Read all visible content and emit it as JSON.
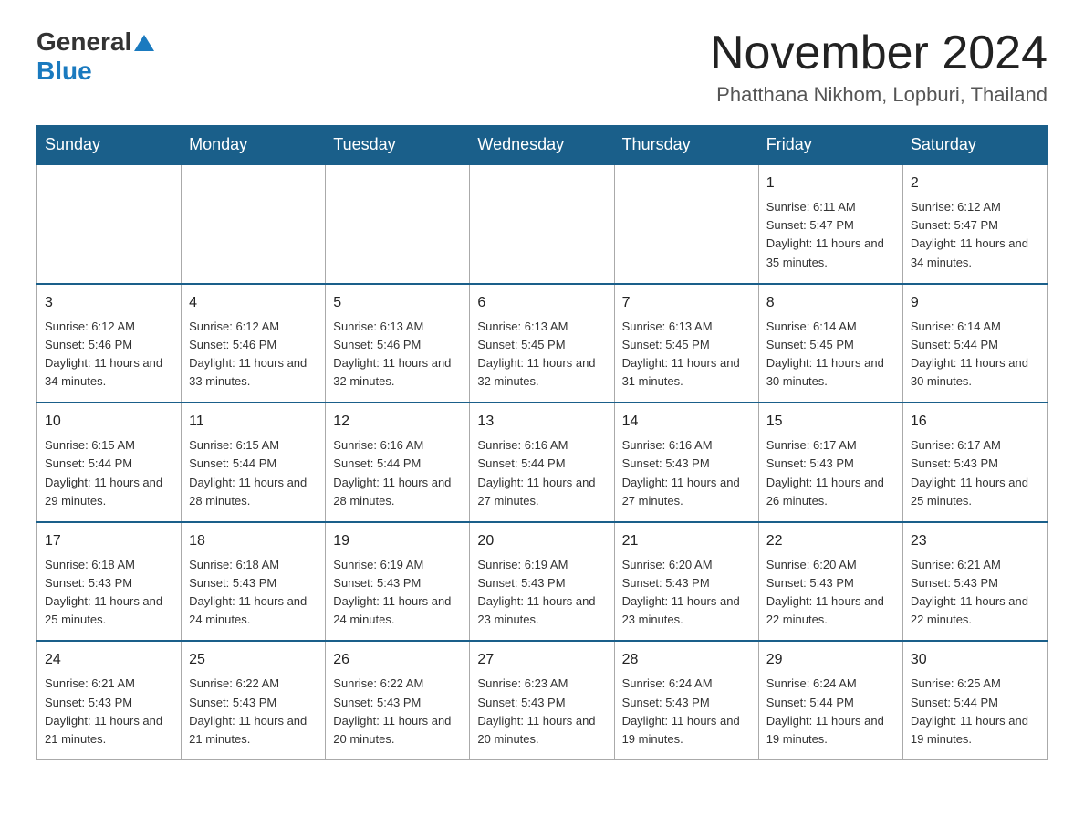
{
  "header": {
    "logo_general": "General",
    "logo_blue": "Blue",
    "month_title": "November 2024",
    "location": "Phatthana Nikhom, Lopburi, Thailand"
  },
  "weekdays": [
    "Sunday",
    "Monday",
    "Tuesday",
    "Wednesday",
    "Thursday",
    "Friday",
    "Saturday"
  ],
  "weeks": [
    [
      {
        "day": "",
        "info": ""
      },
      {
        "day": "",
        "info": ""
      },
      {
        "day": "",
        "info": ""
      },
      {
        "day": "",
        "info": ""
      },
      {
        "day": "",
        "info": ""
      },
      {
        "day": "1",
        "info": "Sunrise: 6:11 AM\nSunset: 5:47 PM\nDaylight: 11 hours and 35 minutes."
      },
      {
        "day": "2",
        "info": "Sunrise: 6:12 AM\nSunset: 5:47 PM\nDaylight: 11 hours and 34 minutes."
      }
    ],
    [
      {
        "day": "3",
        "info": "Sunrise: 6:12 AM\nSunset: 5:46 PM\nDaylight: 11 hours and 34 minutes."
      },
      {
        "day": "4",
        "info": "Sunrise: 6:12 AM\nSunset: 5:46 PM\nDaylight: 11 hours and 33 minutes."
      },
      {
        "day": "5",
        "info": "Sunrise: 6:13 AM\nSunset: 5:46 PM\nDaylight: 11 hours and 32 minutes."
      },
      {
        "day": "6",
        "info": "Sunrise: 6:13 AM\nSunset: 5:45 PM\nDaylight: 11 hours and 32 minutes."
      },
      {
        "day": "7",
        "info": "Sunrise: 6:13 AM\nSunset: 5:45 PM\nDaylight: 11 hours and 31 minutes."
      },
      {
        "day": "8",
        "info": "Sunrise: 6:14 AM\nSunset: 5:45 PM\nDaylight: 11 hours and 30 minutes."
      },
      {
        "day": "9",
        "info": "Sunrise: 6:14 AM\nSunset: 5:44 PM\nDaylight: 11 hours and 30 minutes."
      }
    ],
    [
      {
        "day": "10",
        "info": "Sunrise: 6:15 AM\nSunset: 5:44 PM\nDaylight: 11 hours and 29 minutes."
      },
      {
        "day": "11",
        "info": "Sunrise: 6:15 AM\nSunset: 5:44 PM\nDaylight: 11 hours and 28 minutes."
      },
      {
        "day": "12",
        "info": "Sunrise: 6:16 AM\nSunset: 5:44 PM\nDaylight: 11 hours and 28 minutes."
      },
      {
        "day": "13",
        "info": "Sunrise: 6:16 AM\nSunset: 5:44 PM\nDaylight: 11 hours and 27 minutes."
      },
      {
        "day": "14",
        "info": "Sunrise: 6:16 AM\nSunset: 5:43 PM\nDaylight: 11 hours and 27 minutes."
      },
      {
        "day": "15",
        "info": "Sunrise: 6:17 AM\nSunset: 5:43 PM\nDaylight: 11 hours and 26 minutes."
      },
      {
        "day": "16",
        "info": "Sunrise: 6:17 AM\nSunset: 5:43 PM\nDaylight: 11 hours and 25 minutes."
      }
    ],
    [
      {
        "day": "17",
        "info": "Sunrise: 6:18 AM\nSunset: 5:43 PM\nDaylight: 11 hours and 25 minutes."
      },
      {
        "day": "18",
        "info": "Sunrise: 6:18 AM\nSunset: 5:43 PM\nDaylight: 11 hours and 24 minutes."
      },
      {
        "day": "19",
        "info": "Sunrise: 6:19 AM\nSunset: 5:43 PM\nDaylight: 11 hours and 24 minutes."
      },
      {
        "day": "20",
        "info": "Sunrise: 6:19 AM\nSunset: 5:43 PM\nDaylight: 11 hours and 23 minutes."
      },
      {
        "day": "21",
        "info": "Sunrise: 6:20 AM\nSunset: 5:43 PM\nDaylight: 11 hours and 23 minutes."
      },
      {
        "day": "22",
        "info": "Sunrise: 6:20 AM\nSunset: 5:43 PM\nDaylight: 11 hours and 22 minutes."
      },
      {
        "day": "23",
        "info": "Sunrise: 6:21 AM\nSunset: 5:43 PM\nDaylight: 11 hours and 22 minutes."
      }
    ],
    [
      {
        "day": "24",
        "info": "Sunrise: 6:21 AM\nSunset: 5:43 PM\nDaylight: 11 hours and 21 minutes."
      },
      {
        "day": "25",
        "info": "Sunrise: 6:22 AM\nSunset: 5:43 PM\nDaylight: 11 hours and 21 minutes."
      },
      {
        "day": "26",
        "info": "Sunrise: 6:22 AM\nSunset: 5:43 PM\nDaylight: 11 hours and 20 minutes."
      },
      {
        "day": "27",
        "info": "Sunrise: 6:23 AM\nSunset: 5:43 PM\nDaylight: 11 hours and 20 minutes."
      },
      {
        "day": "28",
        "info": "Sunrise: 6:24 AM\nSunset: 5:43 PM\nDaylight: 11 hours and 19 minutes."
      },
      {
        "day": "29",
        "info": "Sunrise: 6:24 AM\nSunset: 5:44 PM\nDaylight: 11 hours and 19 minutes."
      },
      {
        "day": "30",
        "info": "Sunrise: 6:25 AM\nSunset: 5:44 PM\nDaylight: 11 hours and 19 minutes."
      }
    ]
  ]
}
